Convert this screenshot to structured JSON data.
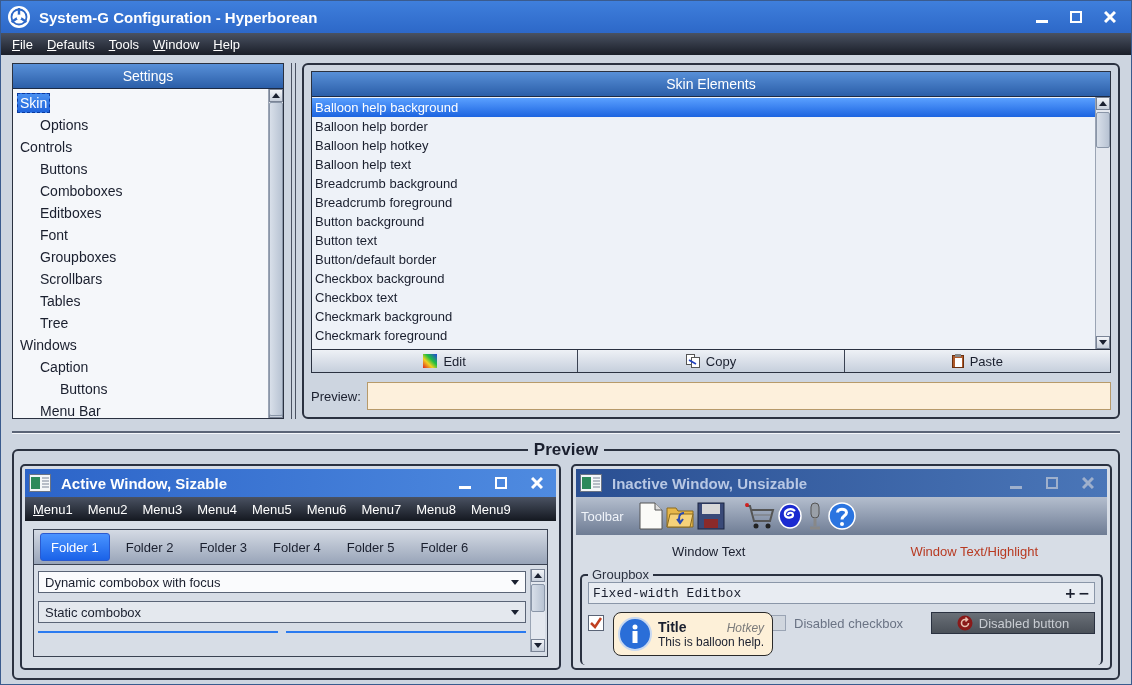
{
  "window": {
    "title": "System-G Configuration - Hyperborean"
  },
  "menu": [
    "File",
    "Defaults",
    "Tools",
    "Window",
    "Help"
  ],
  "settings": {
    "title": "Settings",
    "tree": [
      {
        "label": "Skin",
        "selected": true,
        "children": [
          {
            "label": "Options",
            "selected": false
          }
        ]
      },
      {
        "label": "Controls",
        "selected": false,
        "children": [
          {
            "label": "Buttons",
            "selected": false
          },
          {
            "label": "Comboboxes",
            "selected": false
          },
          {
            "label": "Editboxes",
            "selected": false
          },
          {
            "label": "Font",
            "selected": false
          },
          {
            "label": "Groupboxes",
            "selected": false
          },
          {
            "label": "Scrollbars",
            "selected": false
          },
          {
            "label": "Tables",
            "selected": false
          },
          {
            "label": "Tree",
            "selected": false
          }
        ]
      },
      {
        "label": "Windows",
        "selected": false,
        "children": [
          {
            "label": "Caption",
            "selected": false,
            "children": [
              {
                "label": "Buttons",
                "selected": false
              }
            ]
          },
          {
            "label": "Menu Bar",
            "selected": false
          }
        ]
      }
    ]
  },
  "skin_elements": {
    "title": "Skin Elements",
    "items": [
      {
        "label": "Balloon help background",
        "selected": true
      },
      {
        "label": "Balloon help border",
        "selected": false
      },
      {
        "label": "Balloon help hotkey",
        "selected": false
      },
      {
        "label": "Balloon help text",
        "selected": false
      },
      {
        "label": "Breadcrumb background",
        "selected": false
      },
      {
        "label": "Breadcrumb foreground",
        "selected": false
      },
      {
        "label": "Button background",
        "selected": false
      },
      {
        "label": "Button text",
        "selected": false
      },
      {
        "label": "Button/default border",
        "selected": false
      },
      {
        "label": "Checkbox background",
        "selected": false
      },
      {
        "label": "Checkbox text",
        "selected": false
      },
      {
        "label": "Checkmark background",
        "selected": false
      },
      {
        "label": "Checkmark foreground",
        "selected": false
      }
    ],
    "buttons": [
      {
        "label": "Edit",
        "kind": "edit"
      },
      {
        "label": "Copy",
        "kind": "copy"
      },
      {
        "label": "Paste",
        "kind": "paste"
      }
    ],
    "preview_label": "Preview:"
  },
  "preview": {
    "title": "Preview",
    "active_window": {
      "title": "Active Window, Sizable",
      "active": true,
      "menu": [
        {
          "label": "Menu1",
          "underlined": true
        },
        {
          "label": "Menu2",
          "underlined": false
        },
        {
          "label": "Menu3",
          "underlined": false
        },
        {
          "label": "Menu4",
          "underlined": false
        },
        {
          "label": "Menu5",
          "underlined": false
        },
        {
          "label": "Menu6",
          "underlined": false
        },
        {
          "label": "Menu7",
          "underlined": false
        },
        {
          "label": "Menu8",
          "underlined": false
        },
        {
          "label": "Menu9",
          "underlined": false
        }
      ],
      "tabs": [
        {
          "label": "Folder 1",
          "selected": true
        },
        {
          "label": "Folder 2",
          "selected": false
        },
        {
          "label": "Folder 3",
          "selected": false
        },
        {
          "label": "Folder 4",
          "selected": false
        },
        {
          "label": "Folder 5",
          "selected": false
        },
        {
          "label": "Folder 6",
          "selected": false
        }
      ],
      "comboboxes": [
        {
          "value": "Dynamic combobox with focus",
          "focused": true
        },
        {
          "value": "Static combobox",
          "focused": false
        }
      ]
    },
    "inactive_window": {
      "title": "Inactive Window, Unsizable",
      "active": false,
      "toolbar_label": "Toolbar",
      "window_text": "Window Text",
      "highlight_text": "Window Text/Highlight",
      "groupbox": {
        "title": "Groupbox",
        "editbox": {
          "value": "Fixed-width Editbox"
        },
        "spin": [
          "+",
          "−"
        ],
        "checkboxes": [
          {
            "checked": true,
            "disabled": false
          },
          {
            "label": "Disabled checkbox",
            "checked": false,
            "disabled": true
          }
        ],
        "button": {
          "label": "Disabled button",
          "disabled": true
        }
      },
      "balloon": {
        "title": "Title",
        "hotkey": "Hotkey",
        "text": "This is balloon help."
      }
    }
  }
}
